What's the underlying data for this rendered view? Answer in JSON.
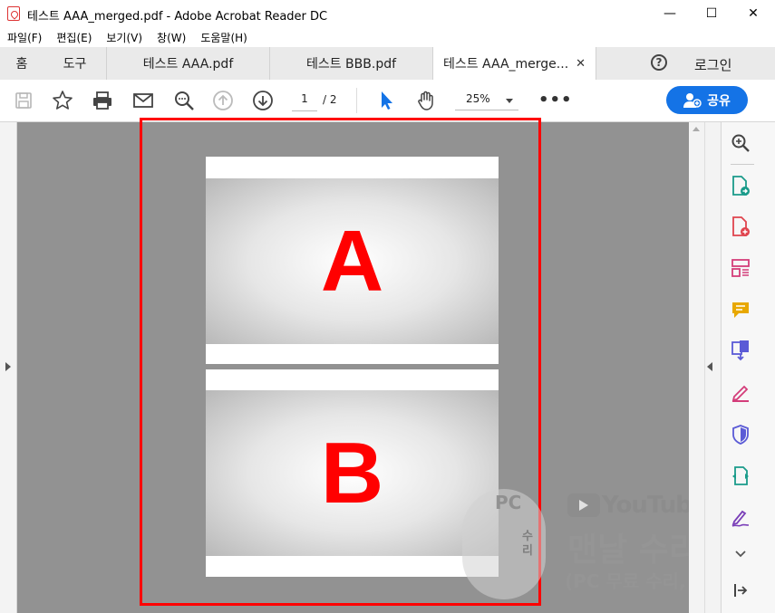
{
  "window": {
    "title": "테스트 AAA_merged.pdf - Adobe Acrobat Reader DC",
    "minimize_glyph": "—",
    "maximize_glyph": "☐",
    "close_glyph": "✕"
  },
  "menu": [
    "파일(F)",
    "편집(E)",
    "보기(V)",
    "창(W)",
    "도움말(H)"
  ],
  "tabs": {
    "home": "홈",
    "tools": "도구",
    "documents": [
      {
        "label": "테스트 AAA.pdf",
        "active": false
      },
      {
        "label": "테스트 BBB.pdf",
        "active": false
      },
      {
        "label": "테스트 AAA_merge...",
        "active": true
      }
    ],
    "close_glyph": "✕",
    "help_glyph": "?",
    "login": "로그인"
  },
  "toolbar": {
    "page_current": "1",
    "page_total": "/ 2",
    "zoom": "25%",
    "more_glyph": "•••",
    "share_label": "공유",
    "icons": [
      "save-icon",
      "star-icon",
      "print-icon",
      "mail-icon",
      "zoom-search-icon",
      "page-up-icon",
      "page-down-icon",
      "select-cursor-icon",
      "hand-tool-icon"
    ]
  },
  "document": {
    "pages": [
      {
        "letter": "A"
      },
      {
        "letter": "B"
      }
    ],
    "highlight_color": "#ff0000",
    "letter_color": "#ff0000"
  },
  "right_pane_icons": [
    "zoom-search-icon",
    "export-pdf-icon",
    "create-pdf-icon",
    "organize-pages-icon",
    "comment-icon",
    "combine-files-icon",
    "fill-sign-icon",
    "protect-icon",
    "share-link-icon",
    "sign-icon",
    "chevron-down-icon",
    "collapse-pane-icon"
  ],
  "watermark": {
    "badge_text": "PC",
    "badge_vertical": "수리",
    "youtube": "YouTube",
    "channel": "맨날 수리야",
    "subtitle": "(PC 무료 수리, 꿀팁)"
  },
  "colors": {
    "accent": "#1473e6",
    "tab_bar": "#eaeaea",
    "doc_background": "#929292"
  }
}
